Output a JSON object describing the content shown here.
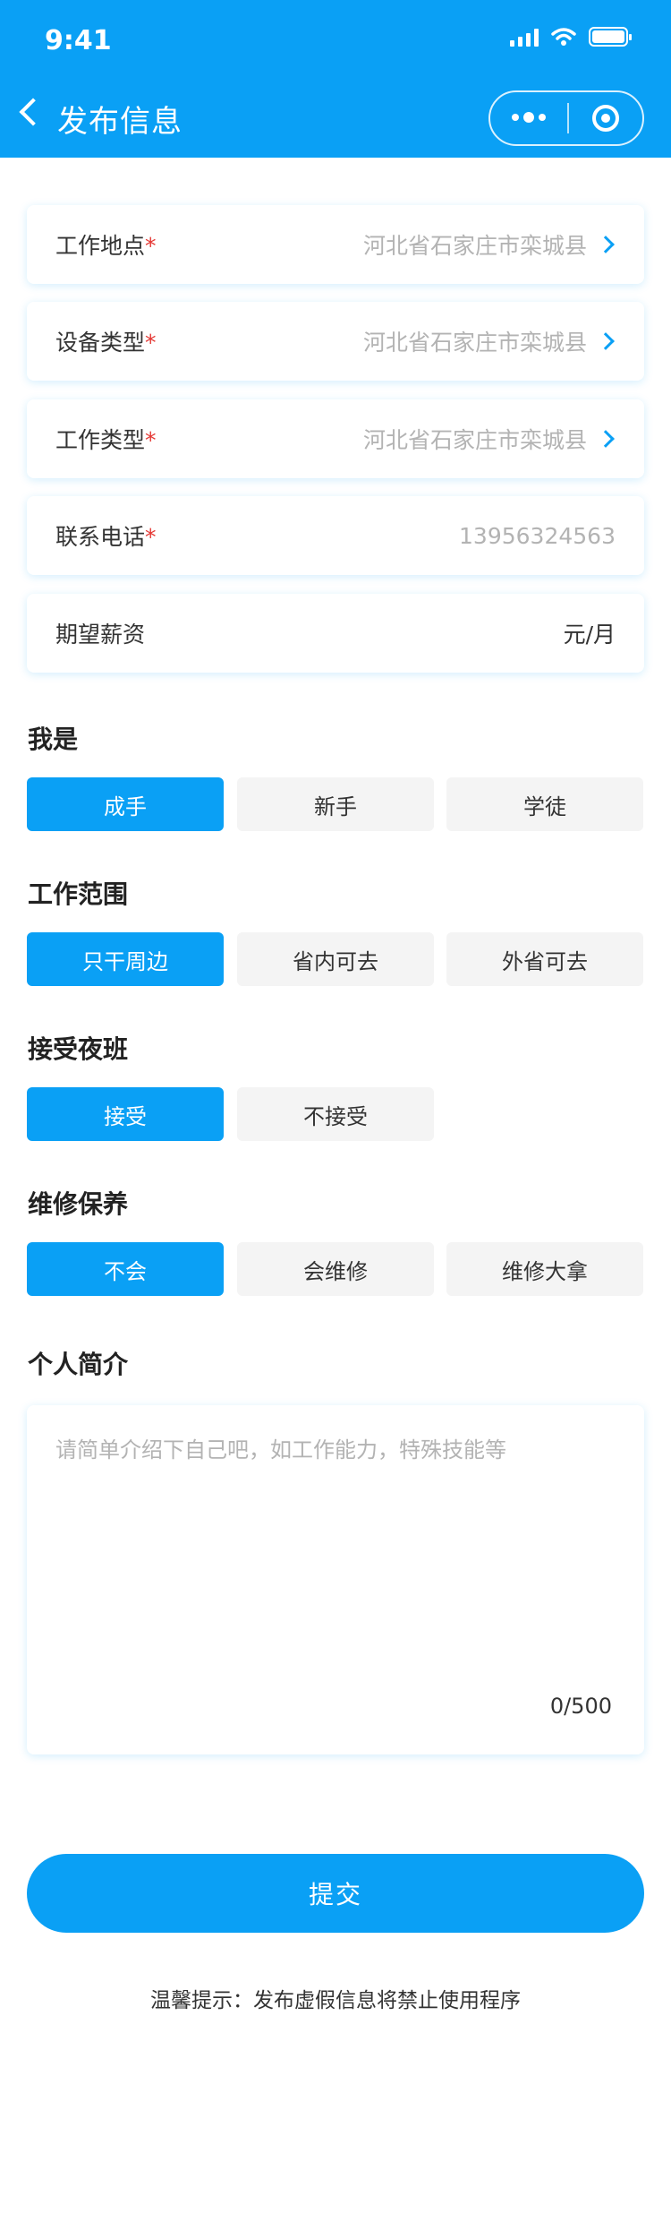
{
  "status_bar": {
    "time": "9:41"
  },
  "nav": {
    "title": "发布信息"
  },
  "fields": [
    {
      "label": "工作地点",
      "required_mark": "*",
      "value": "河北省石家庄市栾城县"
    },
    {
      "label": "设备类型",
      "required_mark": "*",
      "value": "河北省石家庄市栾城县"
    },
    {
      "label": "工作类型",
      "required_mark": "*",
      "value": "河北省石家庄市栾城县"
    },
    {
      "label": "联系电话",
      "required_mark": "*",
      "placeholder": "13956324563"
    },
    {
      "label": "期望薪资",
      "unit": "元/月"
    }
  ],
  "groups": [
    {
      "title": "我是",
      "options": [
        "成手",
        "新手",
        "学徒"
      ],
      "selected": "成手"
    },
    {
      "title": "工作范围",
      "options": [
        "只干周边",
        "省内可去",
        "外省可去"
      ],
      "selected": "只干周边"
    },
    {
      "title": "接受夜班",
      "options": [
        "接受",
        "不接受"
      ],
      "selected": "接受"
    },
    {
      "title": "维修保养",
      "options": [
        "不会",
        "会维修",
        "维修大拿"
      ],
      "selected": "不会"
    }
  ],
  "intro": {
    "title": "个人简介",
    "placeholder": "请简单介绍下自己吧，如工作能力，特殊技能等",
    "counter": "0/500"
  },
  "submit_label": "提交",
  "tip": "温馨提示：发布虚假信息将禁止使用程序",
  "colors": {
    "primary": "#0aa0f5",
    "required": "#e53935",
    "option_bg": "#f4f4f4"
  },
  "icons": [
    "back-arrow-icon",
    "more-dots-icon",
    "target-icon",
    "chevron-right-icon"
  ]
}
